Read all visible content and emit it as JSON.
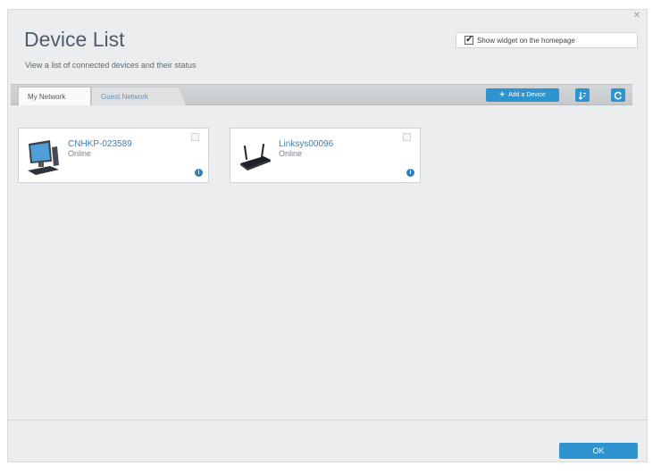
{
  "header": {
    "title": "Device List",
    "subtitle": "View a list of connected devices and their status",
    "close_icon": "close-icon"
  },
  "widget": {
    "checked": true,
    "label": "Show widget on the homepage"
  },
  "tabs": [
    {
      "label": "My Network",
      "active": true
    },
    {
      "label": "Guest Network",
      "active": false
    }
  ],
  "toolbar": {
    "add_device_label": "Add a Device",
    "sort_icon": "sort-icon",
    "refresh_icon": "refresh-icon"
  },
  "devices": [
    {
      "name": "CNHKP-023589",
      "status": "Online",
      "icon": "desktop-computer-icon"
    },
    {
      "name": "Linksys00096",
      "status": "Online",
      "icon": "router-icon"
    }
  ],
  "footer": {
    "ok_label": "OK"
  },
  "colors": {
    "accent": "#2f93cf",
    "link": "#3d7fb5",
    "panel_bg": "#ebedee"
  }
}
